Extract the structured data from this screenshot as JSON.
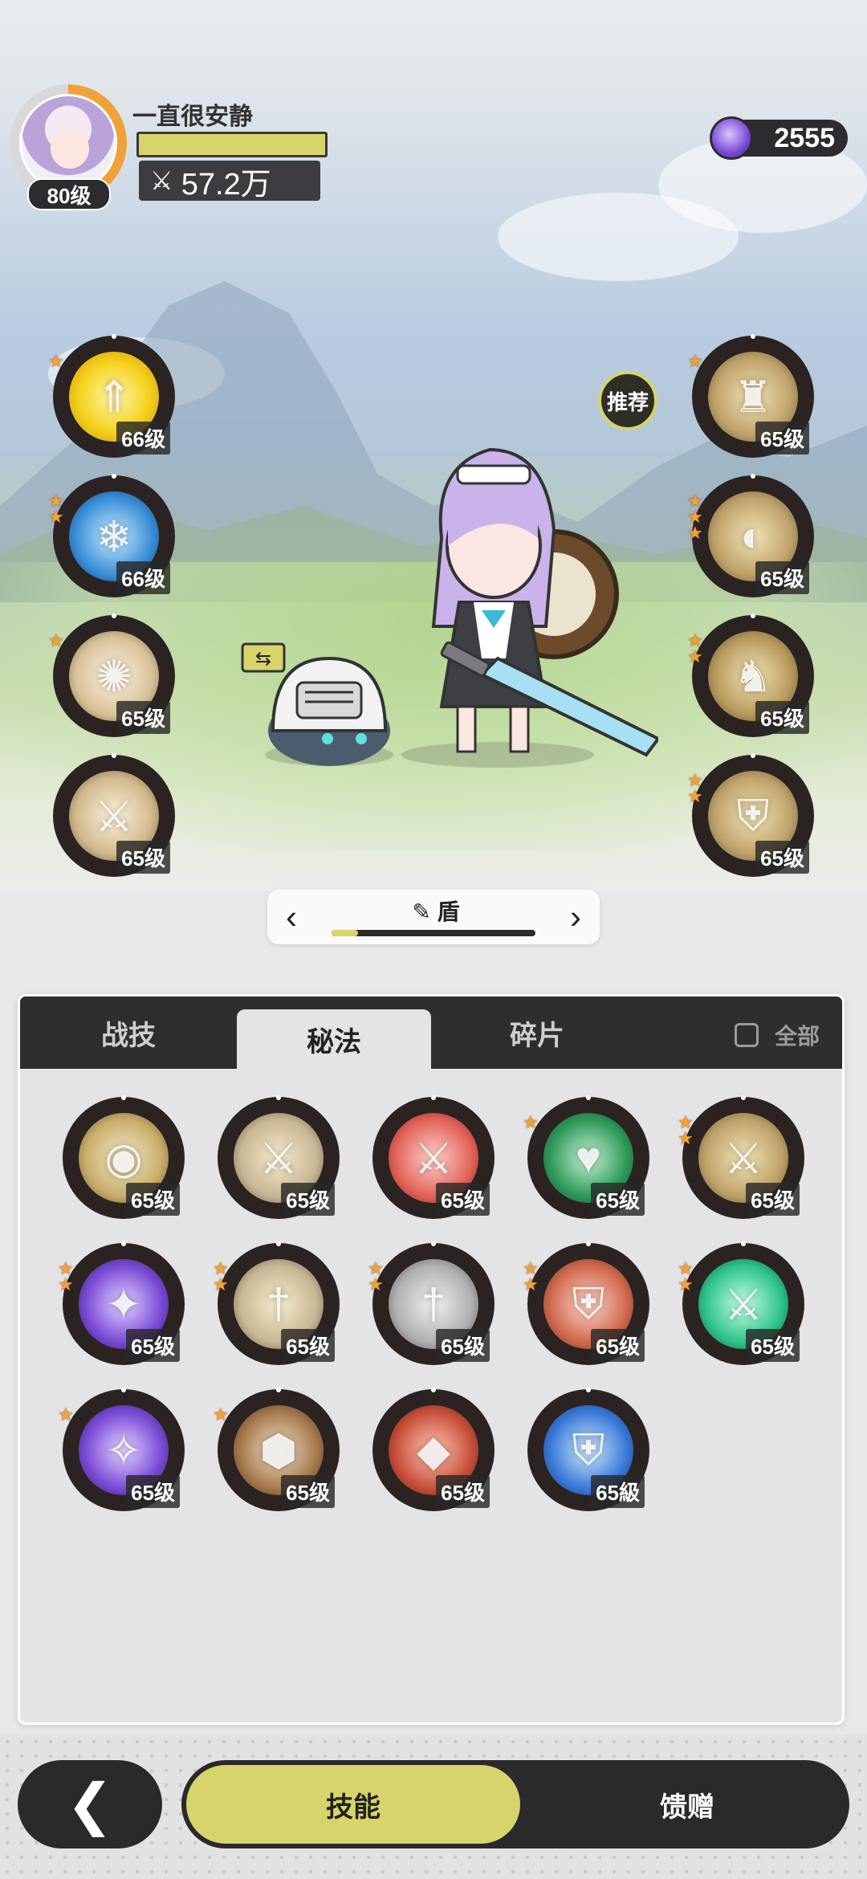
{
  "player": {
    "name": "一直很安静",
    "level": "80级",
    "power": "57.2万"
  },
  "currency": {
    "amount": "2555"
  },
  "recommend_label": "推荐",
  "left_skills": [
    {
      "icon": "arrow-up-burst-icon",
      "level": "66级",
      "stars": 1
    },
    {
      "icon": "frost-ring-icon",
      "level": "66级",
      "stars": 2
    },
    {
      "icon": "shatter-icon",
      "level": "65级",
      "stars": 1
    },
    {
      "icon": "sword-slash-icon",
      "level": "65级",
      "stars": 0
    }
  ],
  "right_skills": [
    {
      "icon": "golem-icon",
      "level": "65级",
      "stars": 1
    },
    {
      "icon": "claw-shield-icon",
      "level": "65级",
      "stars": 3
    },
    {
      "icon": "dragon-head-icon",
      "level": "65级",
      "stars": 2
    },
    {
      "icon": "armor-icon",
      "level": "65级",
      "stars": 2
    }
  ],
  "weapon": {
    "name": "盾",
    "progress": 0.13
  },
  "tabs": [
    {
      "label": "战技",
      "active": false
    },
    {
      "label": "秘法",
      "active": true
    },
    {
      "label": "碎片",
      "active": false
    }
  ],
  "filter": {
    "label": "全部",
    "checked": false
  },
  "arcana_grid": [
    {
      "icon": "eye-icon",
      "level": "65级",
      "rim": "gold",
      "stars": 0
    },
    {
      "icon": "blade-icon",
      "level": "65级",
      "rim": "gold",
      "stars": 0
    },
    {
      "icon": "red-sword-icon",
      "level": "65级",
      "rim": "gold",
      "stars": 0
    },
    {
      "icon": "heart-plus-icon",
      "level": "65级",
      "rim": "orange",
      "stars": 1
    },
    {
      "icon": "broken-blade-icon",
      "level": "65级",
      "rim": "orange",
      "stars": 2
    },
    {
      "icon": "raven-icon",
      "level": "65级",
      "rim": "orange",
      "stars": 2
    },
    {
      "icon": "sword-up-icon",
      "level": "65级",
      "rim": "orange",
      "stars": 2
    },
    {
      "icon": "dagger-icon",
      "level": "65级",
      "rim": "orange",
      "stars": 2
    },
    {
      "icon": "shield-crack-icon",
      "level": "65级",
      "rim": "orange",
      "stars": 2
    },
    {
      "icon": "green-sword-icon",
      "level": "65级",
      "rim": "orange",
      "stars": 2
    },
    {
      "icon": "purple-beast-icon",
      "level": "65级",
      "rim": "orange",
      "stars": 1
    },
    {
      "icon": "hex-shield-icon",
      "level": "65级",
      "rim": "orange",
      "stars": 1
    },
    {
      "icon": "red-stone-icon",
      "level": "65级",
      "rim": "orange",
      "stars": 0
    },
    {
      "icon": "blue-shield-icon",
      "level": "65級",
      "rim": "orange",
      "stars": 0
    }
  ],
  "bottom_nav": {
    "active": "技能",
    "inactive": "馈赠"
  },
  "colors": {
    "accent": "#d6d46b",
    "dark": "#2a2a2c",
    "rim_orange": "#d46a2c",
    "rim_gold": "#f2d25a"
  }
}
